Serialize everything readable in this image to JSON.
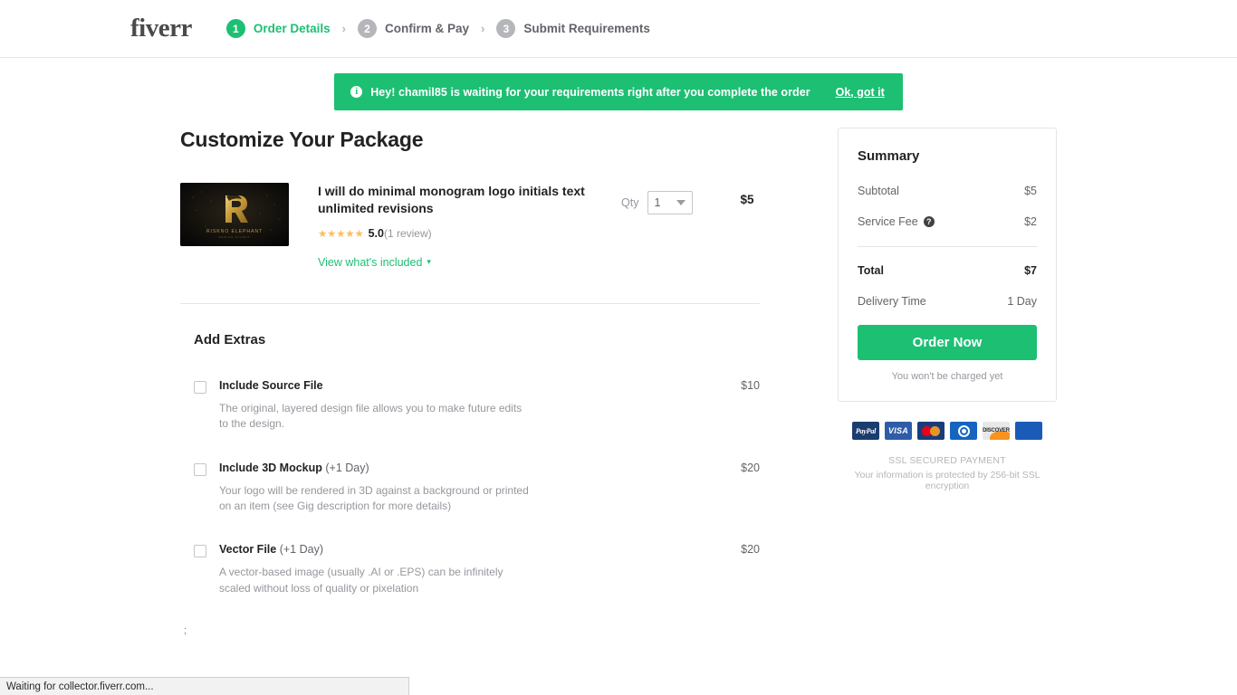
{
  "header": {
    "logo": "fiverr",
    "steps": [
      {
        "num": "1",
        "label": "Order Details",
        "active": true
      },
      {
        "num": "2",
        "label": "Confirm & Pay",
        "active": false
      },
      {
        "num": "3",
        "label": "Submit Requirements",
        "active": false
      }
    ],
    "separator": "›"
  },
  "banner": {
    "icon": "info-icon",
    "icon_glyph": "i",
    "text": "Hey! chamil85 is waiting for your requirements right after you complete the order",
    "action_label": "Ok, got it",
    "background_color": "#1dbf73"
  },
  "main": {
    "page_title": "Customize Your Package",
    "gig": {
      "title": "I will do minimal monogram logo initials text unlimited revisions",
      "thumbnail_alt": "RISKNO ELEPHANT gold monogram R logo",
      "thumbnail_text": "RISKNO ELEPHANT",
      "stars": "★★★★★",
      "rating": "5.0",
      "review_count": "(1 review)",
      "included_link": "View what's included",
      "chevron": "∨",
      "qty_label": "Qty",
      "qty_value": "1",
      "price": "$5"
    },
    "extras": {
      "title": "Add Extras",
      "items": [
        {
          "name": "Include Source File",
          "days": "",
          "description": "The original, layered design file allows you to make future edits to the design.",
          "price": "$10",
          "checked": false
        },
        {
          "name": "Include 3D Mockup",
          "days": "(+1 Day)",
          "description": "Your logo will be rendered in 3D against a background or printed on an item (see Gig description for more details)",
          "price": "$20",
          "checked": false
        },
        {
          "name": "Vector File",
          "days": "(+1 Day)",
          "description": "A vector-based image (usually .AI or .EPS) can be infinitely scaled without loss of quality or pixelation",
          "price": "$20",
          "checked": false
        }
      ],
      "trailing_mark": ";"
    }
  },
  "summary": {
    "title": "Summary",
    "subtotal_label": "Subtotal",
    "subtotal_value": "$5",
    "service_fee_label": "Service Fee",
    "service_fee_help": "?",
    "service_fee_value": "$2",
    "total_label": "Total",
    "total_value": "$7",
    "delivery_label": "Delivery Time",
    "delivery_value": "1 Day",
    "order_button": "Order Now",
    "charge_note": "You won't be charged yet",
    "accent_color": "#1dbf73"
  },
  "payments": {
    "methods": [
      "PayPal",
      "VISA",
      "MasterCard",
      "Diners Club",
      "DISCOVER",
      "JCB"
    ],
    "paypal_label": "PayPal",
    "visa_label": "VISA",
    "discover_label": "DISCOVER",
    "ssl_title": "SSL SECURED PAYMENT",
    "ssl_sub": "Your information is protected by 256-bit SSL encryption"
  },
  "statusbar": {
    "text": "Waiting for collector.fiverr.com..."
  }
}
